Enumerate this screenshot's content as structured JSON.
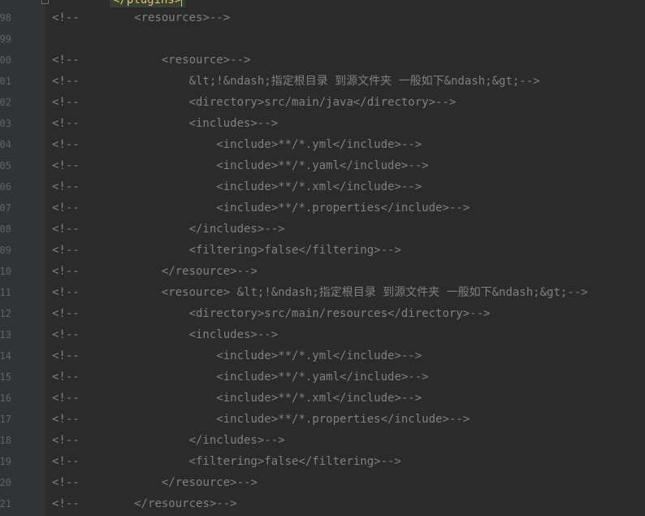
{
  "editor": {
    "top_partial_line": "</plugins>",
    "lines": [
      {
        "number": "98",
        "prefix": "<!--",
        "indent": "        ",
        "code": "<resources>-->"
      },
      {
        "number": "99",
        "prefix": "",
        "indent": "",
        "code": ""
      },
      {
        "number": "00",
        "prefix": "<!--",
        "indent": "            ",
        "code": "<resource>-->"
      },
      {
        "number": "01",
        "prefix": "<!--",
        "indent": "                ",
        "code": "&lt;!&ndash;指定根目录 到源文件夹 一般如下&ndash;&gt;-->"
      },
      {
        "number": "02",
        "prefix": "<!--",
        "indent": "                ",
        "code": "<directory>src/main/java</directory>-->"
      },
      {
        "number": "03",
        "prefix": "<!--",
        "indent": "                ",
        "code": "<includes>-->"
      },
      {
        "number": "04",
        "prefix": "<!--",
        "indent": "                    ",
        "code": "<include>**/*.yml</include>-->"
      },
      {
        "number": "05",
        "prefix": "<!--",
        "indent": "                    ",
        "code": "<include>**/*.yaml</include>-->"
      },
      {
        "number": "06",
        "prefix": "<!--",
        "indent": "                    ",
        "code": "<include>**/*.xml</include>-->"
      },
      {
        "number": "07",
        "prefix": "<!--",
        "indent": "                    ",
        "code": "<include>**/*.properties</include>-->"
      },
      {
        "number": "08",
        "prefix": "<!--",
        "indent": "                ",
        "code": "</includes>-->"
      },
      {
        "number": "09",
        "prefix": "<!--",
        "indent": "                ",
        "code": "<filtering>false</filtering>-->"
      },
      {
        "number": "10",
        "prefix": "<!--",
        "indent": "            ",
        "code": "</resource>-->"
      },
      {
        "number": "11",
        "prefix": "<!--",
        "indent": "            ",
        "code": "<resource> &lt;!&ndash;指定根目录 到源文件夹 一般如下&ndash;&gt;-->"
      },
      {
        "number": "12",
        "prefix": "<!--",
        "indent": "                ",
        "code": "<directory>src/main/resources</directory>-->"
      },
      {
        "number": "13",
        "prefix": "<!--",
        "indent": "                ",
        "code": "<includes>-->"
      },
      {
        "number": "14",
        "prefix": "<!--",
        "indent": "                    ",
        "code": "<include>**/*.yml</include>-->"
      },
      {
        "number": "15",
        "prefix": "<!--",
        "indent": "                    ",
        "code": "<include>**/*.yaml</include>-->"
      },
      {
        "number": "16",
        "prefix": "<!--",
        "indent": "                    ",
        "code": "<include>**/*.xml</include>-->"
      },
      {
        "number": "17",
        "prefix": "<!--",
        "indent": "                    ",
        "code": "<include>**/*.properties</include>-->"
      },
      {
        "number": "18",
        "prefix": "<!--",
        "indent": "                ",
        "code": "</includes>-->"
      },
      {
        "number": "19",
        "prefix": "<!--",
        "indent": "                ",
        "code": "<filtering>false</filtering>-->"
      },
      {
        "number": "20",
        "prefix": "<!--",
        "indent": "            ",
        "code": "</resource>-->"
      },
      {
        "number": "21",
        "prefix": "<!--",
        "indent": "        ",
        "code": "</resources>-->"
      }
    ]
  },
  "colors": {
    "background": "#2b2b2b",
    "gutter": "#313335",
    "comment": "#808080",
    "line_number": "#606366",
    "highlight_tag": "#e8bf6a"
  }
}
